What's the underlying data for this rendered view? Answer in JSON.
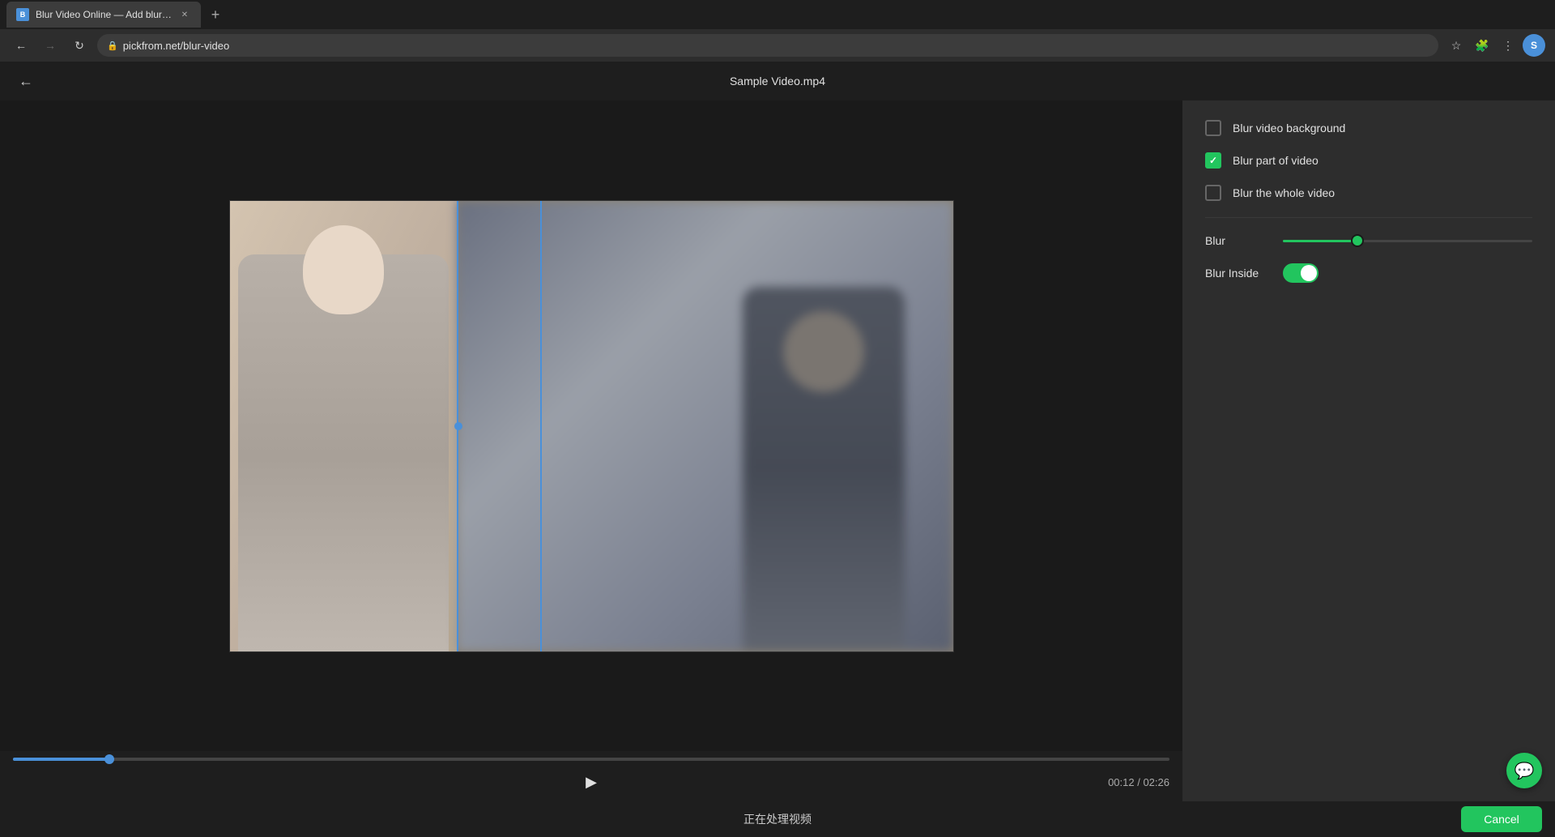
{
  "browser": {
    "tab_title": "Blur Video Online — Add blur e...",
    "tab_favicon": "B",
    "url": "pickfrom.net/blur-video",
    "nav_back_enabled": true,
    "nav_forward_enabled": false
  },
  "header": {
    "video_title": "Sample Video.mp4",
    "back_label": "←"
  },
  "options": {
    "blur_background_label": "Blur video background",
    "blur_background_checked": false,
    "blur_part_label": "Blur part of video",
    "blur_part_checked": true,
    "blur_whole_label": "Blur the whole video",
    "blur_whole_checked": false
  },
  "blur_slider": {
    "label": "Blur",
    "value": 30
  },
  "blur_inside": {
    "label": "Blur Inside",
    "enabled": true
  },
  "video": {
    "current_time": "00:12",
    "total_time": "02:26",
    "progress_percent": 8.3
  },
  "bottom_bar": {
    "processing_text": "正在处理视频",
    "cancel_label": "Cancel"
  },
  "chat": {
    "icon": "💬"
  }
}
